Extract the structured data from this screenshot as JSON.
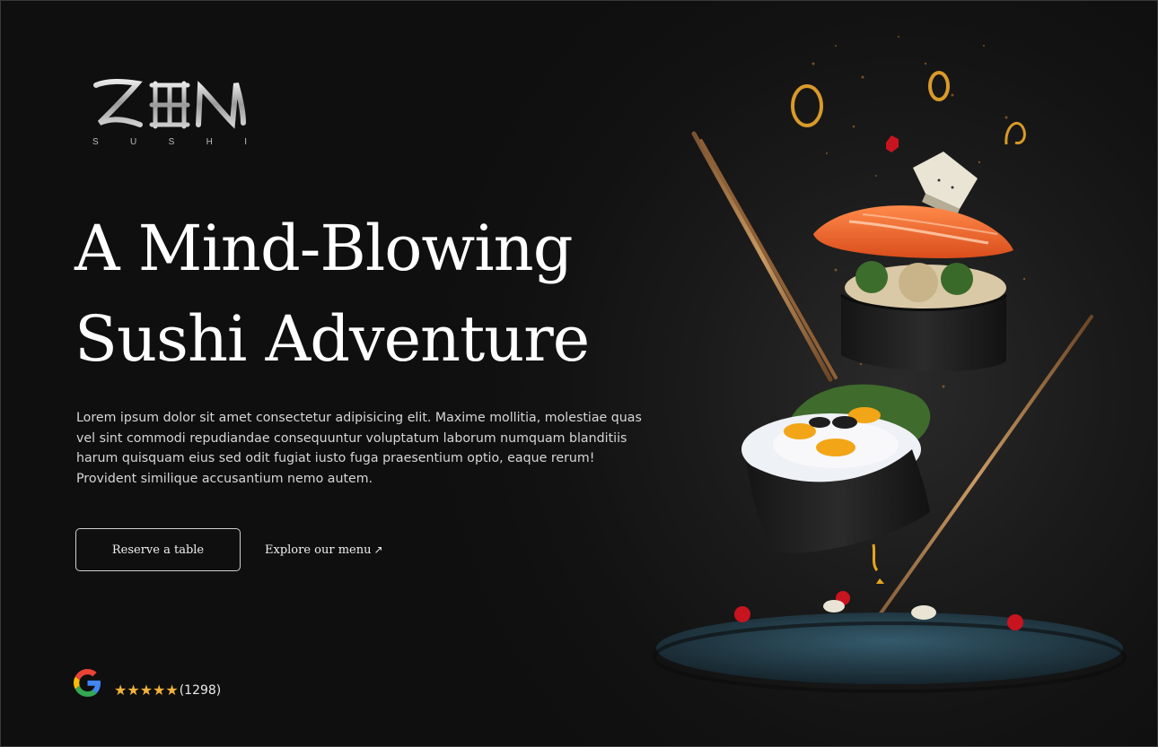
{
  "brand": {
    "logo_text": "ZEN",
    "subtitle_letters": [
      "S",
      "U",
      "S",
      "H",
      "I"
    ]
  },
  "hero": {
    "headline_line1": "A Mind-Blowing",
    "headline_line2": "Sushi Adventure",
    "description": "Lorem ipsum dolor sit amet consectetur adipisicing elit. Maxime mollitia, molestiae quas vel sint commodi repudiandae consequuntur voluptatum laborum numquam blanditiis harum quisquam eius sed odit fugiat iusto fuga praesentium optio, eaque rerum! Provident similique accusantium nemo autem."
  },
  "actions": {
    "reserve_label": "Reserve a table",
    "explore_label": "Explore our menu",
    "explore_icon": "arrow-up-right-icon"
  },
  "rating": {
    "provider_icon": "google-icon",
    "stars": 5,
    "star_glyph": "★",
    "count_text": "(1298)"
  },
  "colors": {
    "background": "#111111",
    "text": "#ffffff",
    "star": "#f3b23d",
    "salmon": "#f26a2e",
    "nori": "#1c1c1c",
    "plate": "#2a4a5a"
  }
}
